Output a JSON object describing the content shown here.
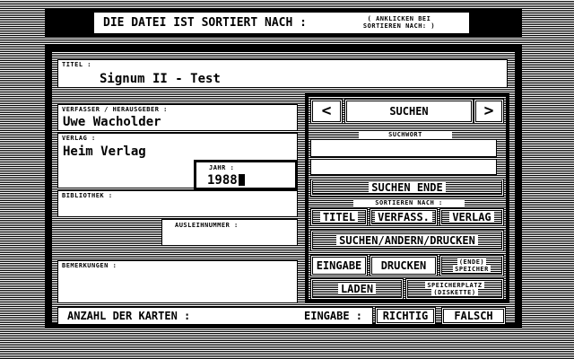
{
  "header": {
    "title": "DIE DATEI IST SORTIERT NACH :",
    "hint_line1": "( ANKLICKEN BEI",
    "hint_line2": "SORTIEREN NACH: )"
  },
  "fields": {
    "titel_label": "TITEL :",
    "titel_value": "Signum II - Test",
    "verfasser_label": "VERFASSER / HERAUSGEBER :",
    "verfasser_value": "Uwe Wacholder",
    "verlag_label": "VERLAG :",
    "verlag_value": "Heim Verlag",
    "jahr_label": "JAHR :",
    "jahr_value": "1988",
    "bibliothek_label": "BIBLIOTHEK :",
    "ausleihnummer_label": "AUSLEIHNUMMER :",
    "bemerkungen_label": "BEMERKUNGEN :"
  },
  "search": {
    "prev_label": "<",
    "suchen_label": "SUCHEN",
    "next_label": ">",
    "suchwort_label": "SUCHWORT",
    "suchen_ende_label": "SUCHEN ENDE"
  },
  "sort": {
    "label": "SORTIEREN NACH :",
    "titel": "TITEL",
    "verfass": "VERFASS.",
    "verlag": "VERLAG"
  },
  "actions": {
    "suchen_andern_drucken": "SUCHEN/ANDERN/DRUCKEN",
    "eingabe": "EINGABE",
    "drucken": "DRUCKEN",
    "ende_speicher_1": "(ENDE)",
    "ende_speicher_2": "SPEICHER",
    "laden": "LADEN",
    "speicherplatz_1": "SPEICHERPLATZ",
    "speicherplatz_2": "(DISKETTE)"
  },
  "footer": {
    "anzahl_label": "ANZAHL DER KARTEN :",
    "mode_label": "EINGABE :",
    "richtig_label": "RICHTIG",
    "falsch_label": "FALSCH"
  }
}
